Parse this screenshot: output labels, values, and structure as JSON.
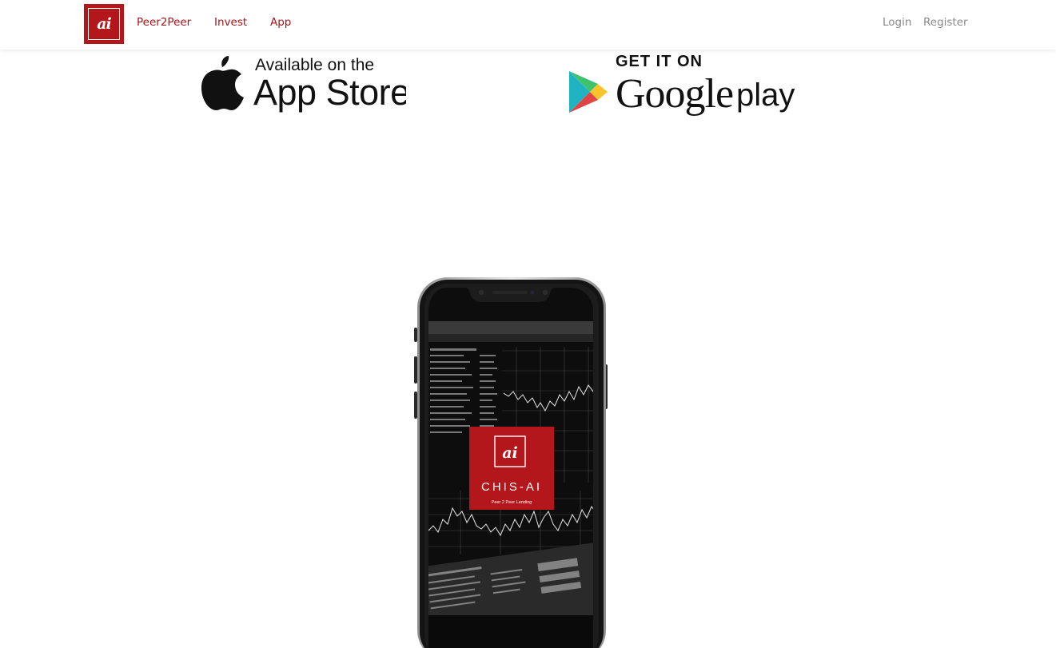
{
  "navbar": {
    "logo_text": "ai",
    "links": [
      {
        "label": "Peer2Peer"
      },
      {
        "label": "Invest"
      },
      {
        "label": "App"
      }
    ],
    "login_label": "Login",
    "register_label": "Register"
  },
  "stores": {
    "appstore_line1": "Available on the",
    "appstore_line2": "App Store",
    "gplay_line1": "GET IT ON",
    "gplay_line2_google": "Google",
    "gplay_line2_play": "play"
  },
  "phone_screen": {
    "logo_text": "ai",
    "brand_name": "CHIS-AI",
    "tagline": "Peer 2 Peer Lending"
  },
  "colors": {
    "brand": "#b3171b",
    "nav_link": "#a8141a",
    "nav_right": "#8a8a8a"
  },
  "icons": [
    "apple-logo-icon",
    "google-play-triangle-icon"
  ]
}
